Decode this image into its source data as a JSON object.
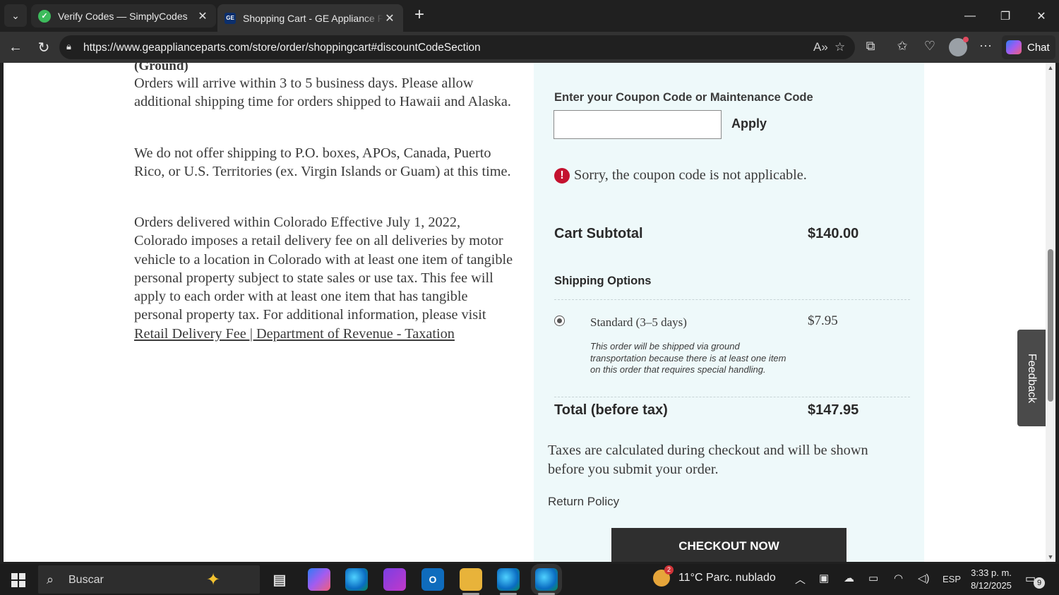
{
  "browser": {
    "tabs": [
      {
        "title": "Verify Codes — SimplyCodes",
        "favicon": "simplycodes-favicon"
      },
      {
        "title": "Shopping Cart - GE Appliance Parts",
        "favicon": "ge-favicon",
        "favicon_text": "GE",
        "active": true
      }
    ],
    "url": "https://www.geapplianceparts.com/store/order/shoppingcart#discountCodeSection",
    "chat_label": "Chat"
  },
  "page": {
    "ground_heading": "(Ground)",
    "paragraphs": [
      "Orders will arrive within 3 to 5 business days. Please allow additional shipping time for orders shipped to Hawaii and Alaska.",
      "We do not offer shipping to P.O. boxes, APOs, Canada, Puerto Rico, or U.S. Territories (ex. Virgin Islands or Guam) at this time.",
      "Orders delivered within Colorado Effective July 1, 2022, Colorado imposes a retail delivery fee on all deliveries by motor vehicle to a location in Colorado with at least one item of tangible personal property subject to state sales or use tax. This fee will apply to each order with at least one item that has tangible personal property tax. For additional information, please visit "
    ],
    "colorado_link": "Retail Delivery Fee | Department of Revenue - Taxation"
  },
  "cart": {
    "coupon_label": "Enter your Coupon Code or Maintenance Code",
    "coupon_value": "",
    "apply_label": "Apply",
    "error_message": "Sorry, the coupon code is not applicable.",
    "subtotal_label": "Cart Subtotal",
    "subtotal_value": "$140.00",
    "shipping_heading": "Shipping Options",
    "shipping_option": {
      "name": "Standard (3–5 days)",
      "price": "$7.95",
      "selected": true,
      "note": "This order will be shipped via ground transportation because there is at least one item on this order that requires special handling."
    },
    "total_label": "Total (before tax)",
    "total_value": "$147.95",
    "tax_note": "Taxes are calculated during checkout and will be shown before you submit your order.",
    "return_policy": "Return Policy",
    "checkout_label": "CHECKOUT NOW",
    "error_color": "#c4122f",
    "sidebar_color": "#eef9fa"
  },
  "feedback_label": "Feedback",
  "taskbar": {
    "search_placeholder": "Buscar",
    "weather": "11°C  Parc. nublado",
    "weather_badge": "2",
    "language": "ESP",
    "time": "3:33 p. m.",
    "date": "8/12/2025",
    "notifications": "9"
  }
}
